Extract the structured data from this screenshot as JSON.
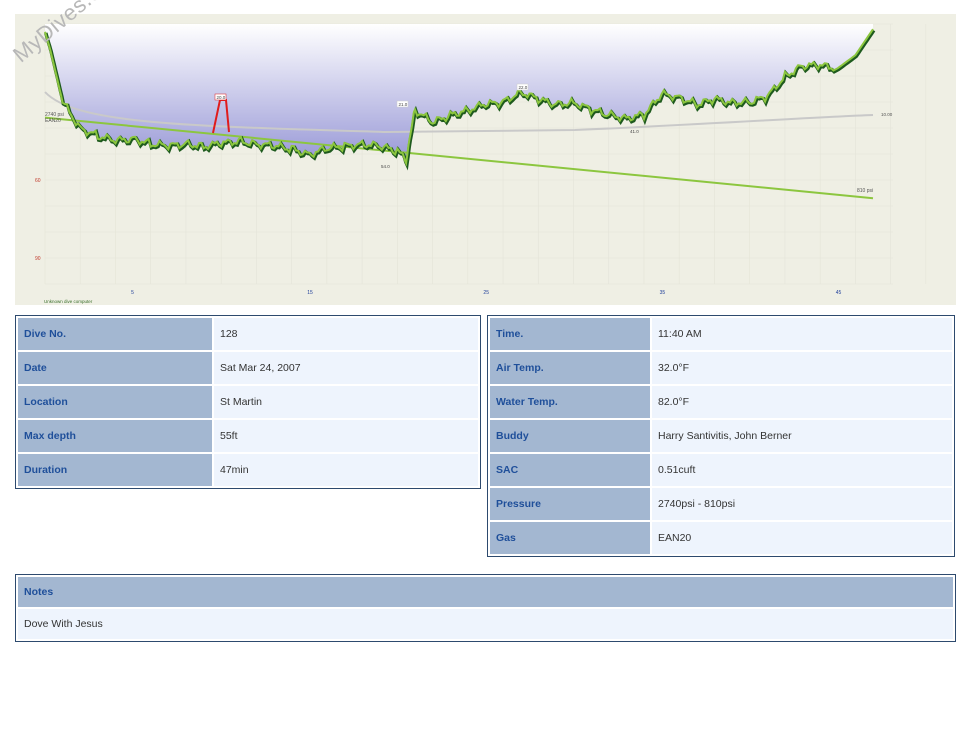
{
  "watermark": "MyDives.com",
  "chart_data": {
    "type": "area",
    "xlabel": "",
    "ylabel": "",
    "ylim": [
      0,
      100
    ],
    "y_inverted": true,
    "x_ticks": [
      "5",
      "15",
      "25",
      "35",
      "45"
    ],
    "y_ticks": [
      "60",
      "90"
    ],
    "footer_text": "Unknown dive computer",
    "labels": {
      "start_pressure": "2740 psi",
      "gas": "EAN20",
      "end_pressure": "810 psi",
      "ascent_marker": "20.0",
      "min_depth_1": "21.0",
      "min_depth_2": "22.0",
      "min_depth_3": "22.0",
      "max_depth": "54.0",
      "depth_41": "41.0",
      "ceiling_label": "10.00"
    },
    "series": [
      {
        "name": "depth",
        "x": [
          0,
          0.3,
          1,
          2,
          3,
          4,
          5,
          6,
          7,
          8,
          9,
          10,
          11,
          12,
          13,
          14,
          15,
          16,
          17,
          18,
          19,
          20,
          20.5,
          21,
          22,
          23,
          24,
          25,
          26,
          27,
          28,
          29,
          30,
          31,
          32,
          33,
          34,
          35,
          36,
          37,
          38,
          39,
          40,
          41,
          42,
          43,
          44,
          45,
          46,
          47
        ],
        "y": [
          3,
          10,
          30,
          40,
          43,
          45,
          44,
          46,
          47,
          46,
          47,
          46,
          45,
          46,
          47,
          48,
          50,
          48,
          47,
          46,
          47,
          49,
          52,
          33,
          38,
          35,
          33,
          31,
          30,
          26,
          29,
          31,
          30,
          33,
          35,
          36,
          35,
          27,
          28,
          31,
          29,
          30,
          30,
          28,
          20,
          16,
          16,
          17,
          12,
          2
        ]
      },
      {
        "name": "pressure",
        "x": [
          0,
          47
        ],
        "y": [
          2740,
          810
        ]
      }
    ]
  },
  "left_table": [
    {
      "label": "Dive No.",
      "value": "128"
    },
    {
      "label": "Date",
      "value": "Sat Mar 24, 2007"
    },
    {
      "label": "Location",
      "value": "St Martin"
    },
    {
      "label": "Max depth",
      "value": "55ft"
    },
    {
      "label": "Duration",
      "value": "47min"
    }
  ],
  "right_table": [
    {
      "label": "Time.",
      "value": "11:40 AM"
    },
    {
      "label": "Air Temp.",
      "value": "32.0°F"
    },
    {
      "label": "Water Temp.",
      "value": "82.0°F"
    },
    {
      "label": "Buddy",
      "value": "Harry Santivitis, John Berner"
    },
    {
      "label": "SAC",
      "value": "0.51cuft"
    },
    {
      "label": "Pressure",
      "value": "2740psi - 810psi"
    },
    {
      "label": "Gas",
      "value": "EAN20"
    }
  ],
  "notes": {
    "label": "Notes",
    "value": "Dove With Jesus"
  }
}
